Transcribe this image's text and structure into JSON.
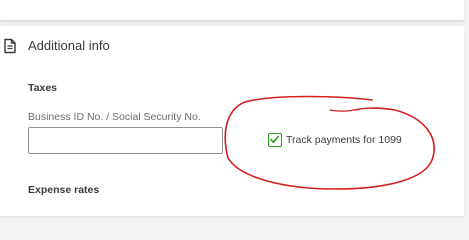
{
  "section": {
    "title": "Additional info",
    "icon": "document-icon"
  },
  "taxes": {
    "heading": "Taxes",
    "business_id_label": "Business ID No. / Social Security No.",
    "business_id_value": "",
    "track_1099_label": "Track payments for 1099",
    "track_1099_checked": true
  },
  "expense_rates": {
    "heading": "Expense rates"
  },
  "colors": {
    "checkbox_accent": "#2ca01c",
    "annotation_stroke": "#d42020"
  }
}
